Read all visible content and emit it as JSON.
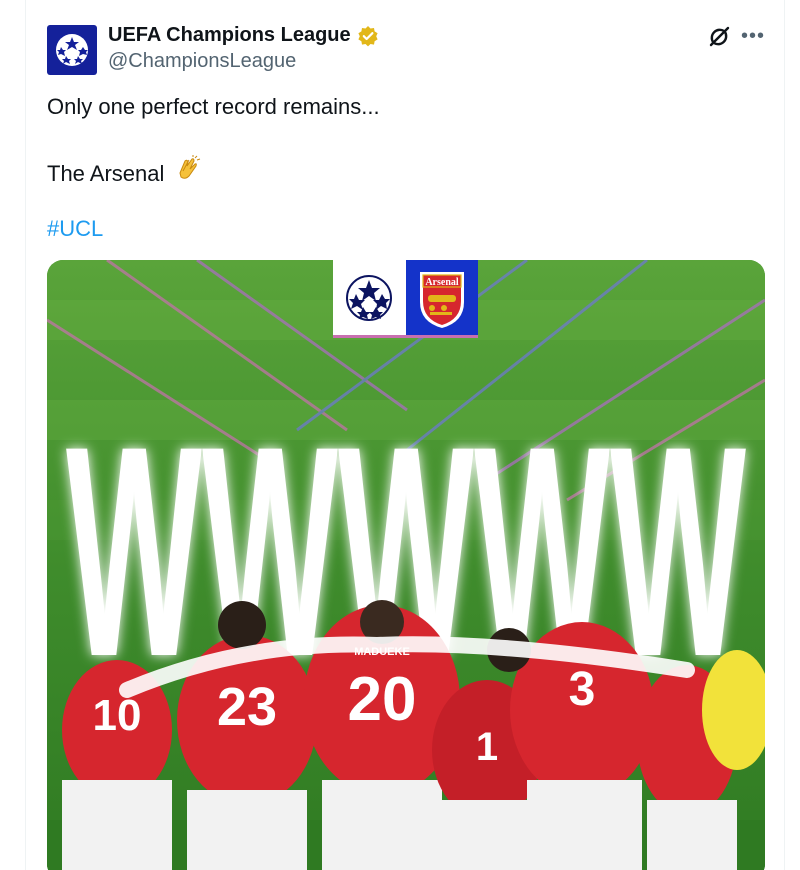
{
  "tweet": {
    "display_name": "UEFA Champions League",
    "handle": "@ChampionsLeague",
    "text_line_1": "Only one perfect record remains...",
    "text_line_2": "The Arsenal",
    "emoji": "clapping-hands",
    "hashtag": "#UCL"
  },
  "media": {
    "badge_text": "Arsenal",
    "headline": "WWWWW",
    "jersey_numbers": [
      "10",
      "23",
      "20",
      "3",
      "1"
    ],
    "jersey_name": "MADUEKE"
  },
  "icons": {
    "avatar": "champions-league-starball",
    "verified": "gold-verified-badge",
    "grok": "grok-icon",
    "more": "more-icon"
  },
  "colors": {
    "link": "#1d9bf0",
    "verified_gold": "#e2b719",
    "avatar_bg": "#14219a",
    "arsenal_red": "#d6262e"
  }
}
